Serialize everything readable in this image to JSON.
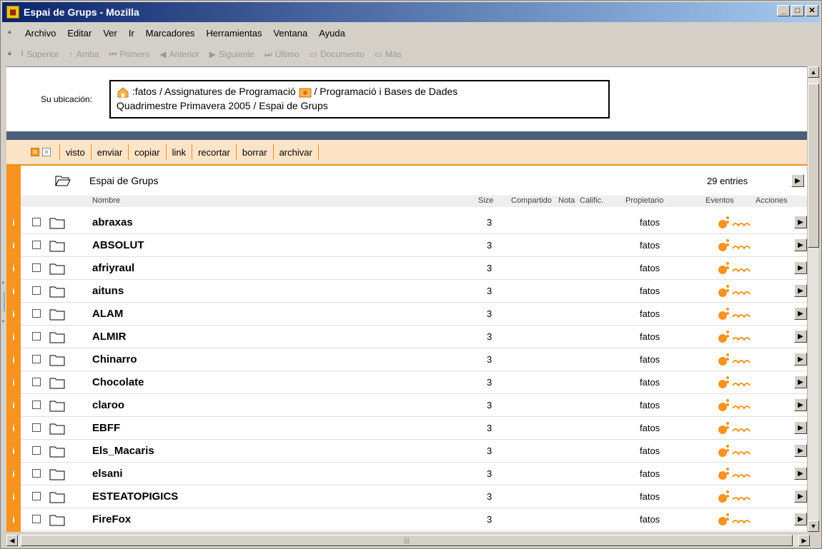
{
  "window": {
    "title": "Espai de Grups - Mozilla"
  },
  "menubar": [
    "Archivo",
    "Editar",
    "Ver",
    "Ir",
    "Marcadores",
    "Herramientas",
    "Ventana",
    "Ayuda"
  ],
  "navbar": [
    "Superior",
    "Arriba",
    "Primero",
    "Anterior",
    "Siguiente",
    "Último",
    "Documento",
    "Más"
  ],
  "location": {
    "label": "Su ubicación:",
    "line1_a": ":fatos / Assignatures de Programació",
    "line1_b": "/ Programació i Bases de Dades",
    "line2": "Quadrimestre Primavera 2005 / Espai de Grups"
  },
  "actions": [
    "visto",
    "enviar",
    "copiar",
    "link",
    "recortar",
    "borrar",
    "archivar"
  ],
  "folder": {
    "title": "Espai de Grups",
    "entries": "29 entries"
  },
  "columns": {
    "name": "Nombre",
    "size": "Size",
    "shared": "Compartido",
    "note": "Nota",
    "grade": "Calific.",
    "owner": "Propietario",
    "events": "Eventos",
    "actions": "Acciones"
  },
  "rows": [
    {
      "name": "abraxas",
      "size": "3",
      "owner": "fatos"
    },
    {
      "name": "ABSOLUT",
      "size": "3",
      "owner": "fatos"
    },
    {
      "name": "afriyraul",
      "size": "3",
      "owner": "fatos"
    },
    {
      "name": "aituns",
      "size": "3",
      "owner": "fatos"
    },
    {
      "name": "ALAM",
      "size": "3",
      "owner": "fatos"
    },
    {
      "name": "ALMIR",
      "size": "3",
      "owner": "fatos"
    },
    {
      "name": "Chinarro",
      "size": "3",
      "owner": "fatos"
    },
    {
      "name": "Chocolate",
      "size": "3",
      "owner": "fatos"
    },
    {
      "name": "claroo",
      "size": "3",
      "owner": "fatos"
    },
    {
      "name": "EBFF",
      "size": "3",
      "owner": "fatos"
    },
    {
      "name": "Els_Macaris",
      "size": "3",
      "owner": "fatos"
    },
    {
      "name": "elsani",
      "size": "3",
      "owner": "fatos"
    },
    {
      "name": "ESTEATOPIGICS",
      "size": "3",
      "owner": "fatos"
    },
    {
      "name": "FireFox",
      "size": "3",
      "owner": "fatos"
    }
  ],
  "colors": {
    "accent": "#f7931e",
    "action_bg": "#fde4c6",
    "dark_bar": "#4a6079"
  }
}
